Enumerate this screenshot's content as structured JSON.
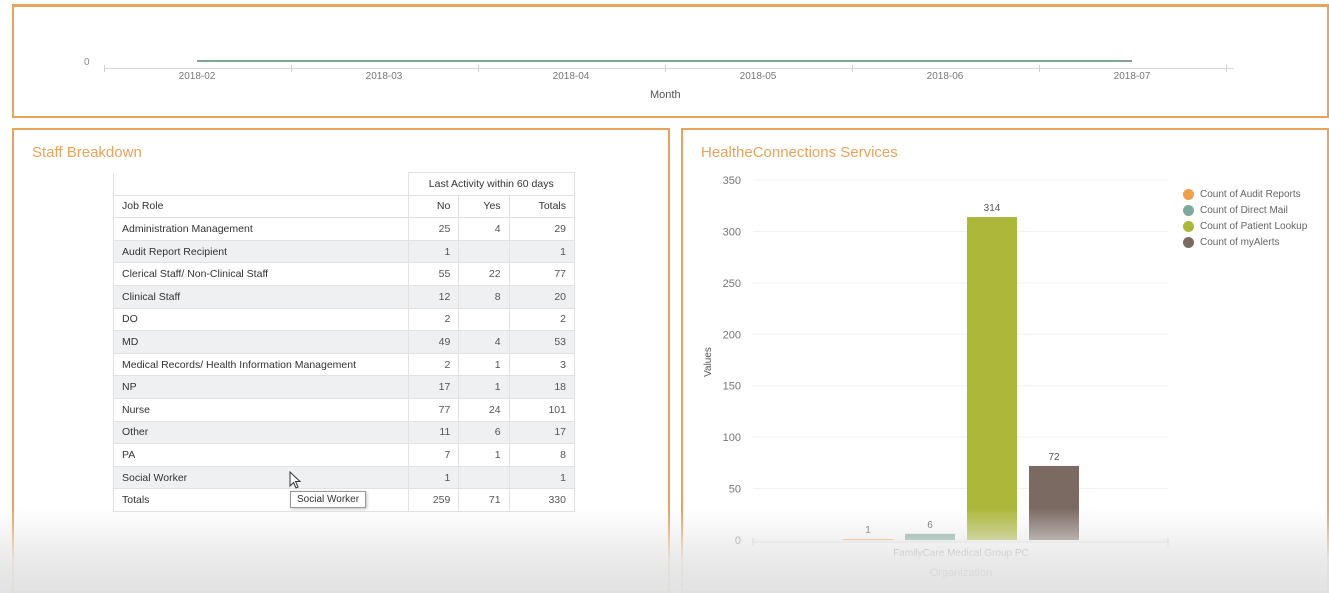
{
  "timeline": {
    "zero_label": "0",
    "months": [
      "2018-02",
      "2018-03",
      "2018-04",
      "2018-05",
      "2018-06",
      "2018-07"
    ],
    "axis_title": "Month"
  },
  "staff": {
    "title": "Staff Breakdown",
    "group_header": "Last Activity within 60 days",
    "columns": [
      "Job Role",
      "No",
      "Yes",
      "Totals"
    ],
    "rows": [
      [
        "Administration Management",
        "25",
        "4",
        "29"
      ],
      [
        "Audit Report Recipient",
        "1",
        "",
        "1"
      ],
      [
        "Clerical Staff/ Non-Clinical Staff",
        "55",
        "22",
        "77"
      ],
      [
        "Clinical Staff",
        "12",
        "8",
        "20"
      ],
      [
        "DO",
        "2",
        "",
        "2"
      ],
      [
        "MD",
        "49",
        "4",
        "53"
      ],
      [
        "Medical Records/ Health Information Management",
        "2",
        "1",
        "3"
      ],
      [
        "NP",
        "17",
        "1",
        "18"
      ],
      [
        "Nurse",
        "77",
        "24",
        "101"
      ],
      [
        "Other",
        "11",
        "6",
        "17"
      ],
      [
        "PA",
        "7",
        "1",
        "8"
      ],
      [
        "Social Worker",
        "1",
        "",
        "1"
      ],
      [
        "Totals",
        "259",
        "71",
        "330"
      ]
    ],
    "tooltip": "Social Worker"
  },
  "hec": {
    "title": "HealtheConnections Services"
  },
  "chart_data": {
    "type": "bar",
    "categories": [
      "FamilyCare Medical Group PC"
    ],
    "series": [
      {
        "name": "Count of Audit Reports",
        "values": [
          1
        ],
        "color": "#f0a04b"
      },
      {
        "name": "Count of Direct Mail",
        "values": [
          6
        ],
        "color": "#7fa89c"
      },
      {
        "name": "Count of Patient Lookup",
        "values": [
          314
        ],
        "color": "#acb83a"
      },
      {
        "name": "Count of myAlerts",
        "values": [
          72
        ],
        "color": "#7b6a62"
      }
    ],
    "xlabel": "Organization",
    "ylabel": "Values",
    "ylim": [
      0,
      350
    ],
    "yticks": [
      0,
      50,
      100,
      150,
      200,
      250,
      300,
      350
    ],
    "legend_position": "top-right",
    "grid": true
  }
}
